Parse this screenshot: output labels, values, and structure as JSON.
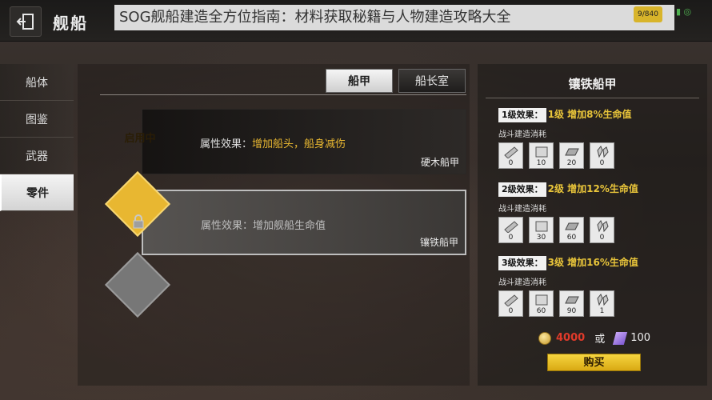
{
  "topbar": {
    "title": "舰船",
    "overlay_title": "SOG舰船建造全方位指南：材料获取秘籍与人物建造攻略大全",
    "status_chip": "9/840",
    "status_icons": "▮ ◎"
  },
  "nav": {
    "items": [
      {
        "label": "船体",
        "active": false
      },
      {
        "label": "图鉴",
        "active": false
      },
      {
        "label": "武器",
        "active": false
      },
      {
        "label": "零件",
        "active": true
      }
    ]
  },
  "tabs": {
    "armor": "船甲",
    "cabin": "船长室"
  },
  "cards": [
    {
      "badge": "启用中",
      "attr_prefix": "属性效果：",
      "attr_value": "增加船头，船身减伤",
      "name": "硬木船甲",
      "locked": false
    },
    {
      "badge": "",
      "attr_prefix": "属性效果：",
      "attr_value": "增加舰船生命值",
      "name": "镶铁船甲",
      "locked": true
    }
  ],
  "detail": {
    "title": "镶铁船甲",
    "subtitle": "战斗建造消耗",
    "levels": [
      {
        "tag": "1级效果：",
        "effect": "1级  增加8%生命值",
        "materials": [
          "0",
          "10",
          "20",
          "0"
        ]
      },
      {
        "tag": "2级效果：",
        "effect": "2级  增加12%生命值",
        "materials": [
          "0",
          "30",
          "60",
          "0"
        ]
      },
      {
        "tag": "3级效果：",
        "effect": "3级  增加16%生命值",
        "materials": [
          "0",
          "60",
          "90",
          "1"
        ]
      }
    ],
    "cost_gold": "4000",
    "cost_or": "或",
    "cost_gem": "100",
    "buy_label": "购买"
  },
  "colors": {
    "accent_gold": "#e8b731",
    "effect_yellow": "#e9c53a",
    "cost_red": "#e03a2a"
  }
}
